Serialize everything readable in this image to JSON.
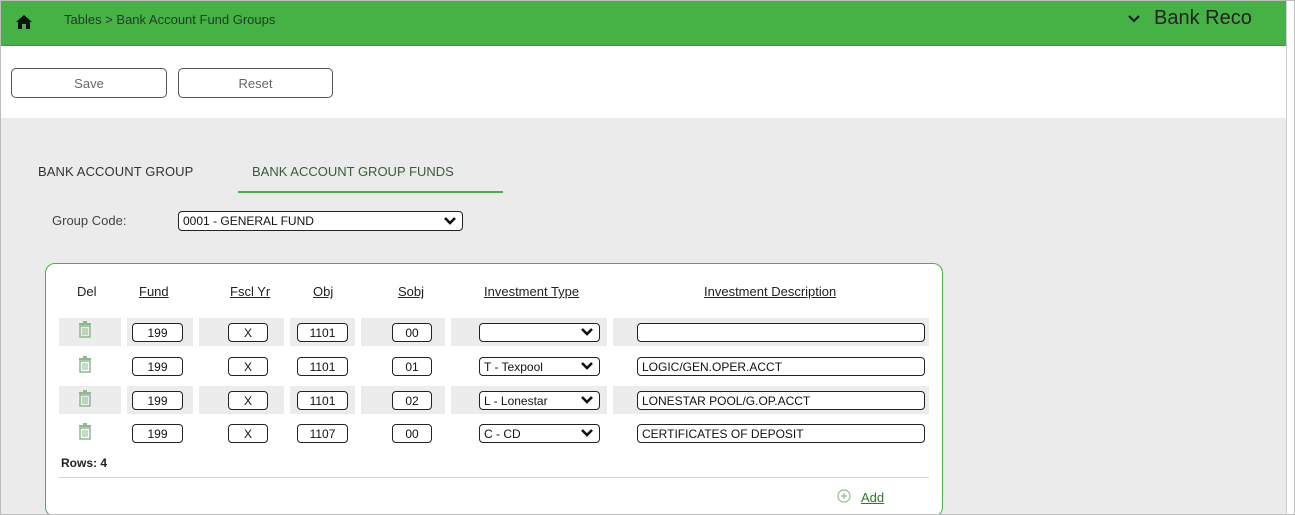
{
  "header": {
    "breadcrumb": "Tables > Bank Account Fund Groups",
    "app_title": "Bank Reco",
    "accent_color": "#46b245"
  },
  "toolbar": {
    "save_label": "Save",
    "reset_label": "Reset"
  },
  "tabs": [
    {
      "label": "BANK ACCOUNT GROUP",
      "active": false
    },
    {
      "label": "BANK ACCOUNT GROUP FUNDS",
      "active": true
    }
  ],
  "group_code": {
    "label": "Group Code:",
    "value": "0001 - GENERAL FUND"
  },
  "table": {
    "headers": {
      "del": "Del",
      "fund": "Fund",
      "fscl_yr": "Fscl Yr",
      "obj": "Obj",
      "sobj": "Sobj",
      "investment_type": "Investment Type",
      "investment_description": "Investment Description"
    },
    "rows": [
      {
        "fund": "199",
        "fscl_yr": "X",
        "obj": "1101",
        "sobj": "00",
        "investment_type": "",
        "investment_description": ""
      },
      {
        "fund": "199",
        "fscl_yr": "X",
        "obj": "1101",
        "sobj": "01",
        "investment_type": "T - Texpool",
        "investment_description": "LOGIC/GEN.OPER.ACCT"
      },
      {
        "fund": "199",
        "fscl_yr": "X",
        "obj": "1101",
        "sobj": "02",
        "investment_type": "L - Lonestar",
        "investment_description": "LONESTAR POOL/G.OP.ACCT"
      },
      {
        "fund": "199",
        "fscl_yr": "X",
        "obj": "1107",
        "sobj": "00",
        "investment_type": "C - CD",
        "investment_description": "CERTIFICATES OF DEPOSIT"
      }
    ],
    "rows_label": "Rows: 4",
    "add_label": "Add"
  }
}
